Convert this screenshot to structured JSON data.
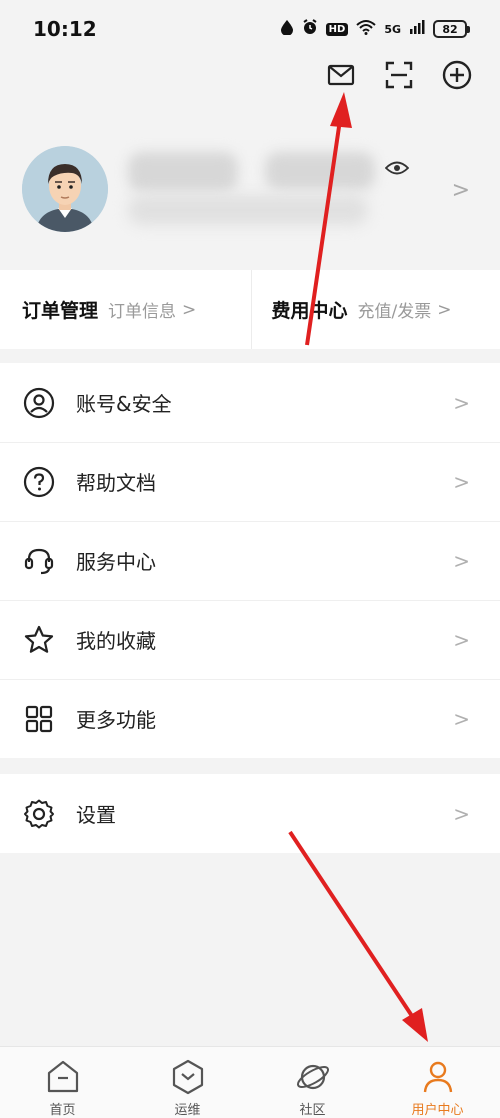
{
  "status_bar": {
    "time": "10:12",
    "hd": "HD",
    "network": "5G",
    "battery": "82"
  },
  "top_actions": [
    "mail-icon",
    "scan-icon",
    "add-icon"
  ],
  "orders": [
    {
      "title": "订单管理",
      "subtitle": "订单信息"
    },
    {
      "title": "费用中心",
      "subtitle": "充值/发票"
    }
  ],
  "menu_group_1": [
    {
      "icon": "user-circle-icon",
      "label": "账号&安全"
    },
    {
      "icon": "help-circle-icon",
      "label": "帮助文档"
    },
    {
      "icon": "headset-icon",
      "label": "服务中心"
    },
    {
      "icon": "star-icon",
      "label": "我的收藏"
    },
    {
      "icon": "grid-icon",
      "label": "更多功能"
    }
  ],
  "menu_group_2": [
    {
      "icon": "settings-icon",
      "label": "设置"
    }
  ],
  "tabbar": [
    {
      "icon": "home-icon",
      "label": "首页"
    },
    {
      "icon": "ops-icon",
      "label": "运维"
    },
    {
      "icon": "planet-icon",
      "label": "社区"
    },
    {
      "icon": "user-icon",
      "label": "用户中心",
      "active": true
    }
  ],
  "chevron": ">",
  "colors": {
    "accent": "#e87a1e",
    "annotation_arrow": "#e02020"
  }
}
